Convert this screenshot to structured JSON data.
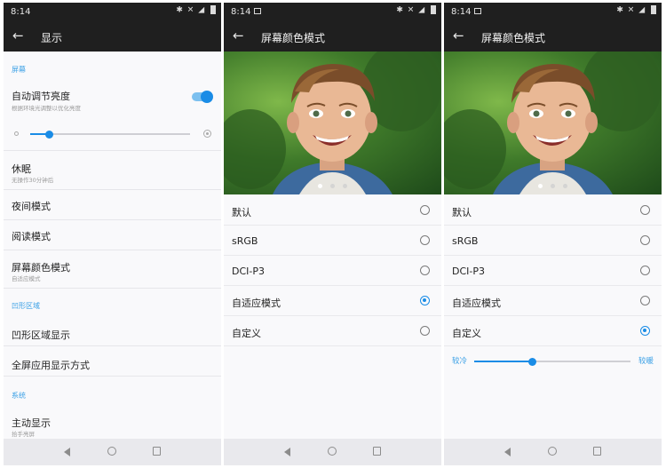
{
  "status": {
    "time": "8:14"
  },
  "panel1": {
    "title": "显示",
    "section_screen": "屏幕",
    "auto_brightness": {
      "label": "自动调节亮度",
      "sub": "根据环境光调整以优化亮度",
      "on": true
    },
    "brightness_level": 0.12,
    "sleep": {
      "label": "休眠",
      "sub": "无操作30分钟后"
    },
    "night_mode": "夜间模式",
    "reading_mode": "阅读模式",
    "color_mode": {
      "label": "屏幕颜色模式",
      "sub": "自适应模式"
    },
    "section_notch": "凹形区域",
    "notch_display": "凹形区域显示",
    "fullscreen_apps": "全屏应用显示方式",
    "section_system": "系统",
    "ambient": {
      "label": "主动显示",
      "sub": "拾手亮屏"
    }
  },
  "panel2": {
    "title": "屏幕颜色模式",
    "options": [
      {
        "label": "默认",
        "selected": false
      },
      {
        "label": "sRGB",
        "selected": false
      },
      {
        "label": "DCI-P3",
        "selected": false
      },
      {
        "label": "自适应模式",
        "selected": true
      },
      {
        "label": "自定义",
        "selected": false
      }
    ]
  },
  "panel3": {
    "title": "屏幕颜色模式",
    "options": [
      {
        "label": "默认",
        "selected": false
      },
      {
        "label": "sRGB",
        "selected": false
      },
      {
        "label": "DCI-P3",
        "selected": false
      },
      {
        "label": "自适应模式",
        "selected": false
      },
      {
        "label": "自定义",
        "selected": true
      }
    ],
    "temperature": {
      "cool_label": "较冷",
      "warm_label": "较暖",
      "level": 0.37
    }
  },
  "colors": {
    "accent": "#1a8ce6",
    "bar": "#1f1f1f"
  },
  "icons": [
    "back-arrow-icon",
    "bluetooth-icon",
    "mute-icon",
    "signal-icon",
    "battery-icon",
    "image-icon",
    "nav-back-icon",
    "nav-home-icon",
    "nav-recent-icon"
  ]
}
